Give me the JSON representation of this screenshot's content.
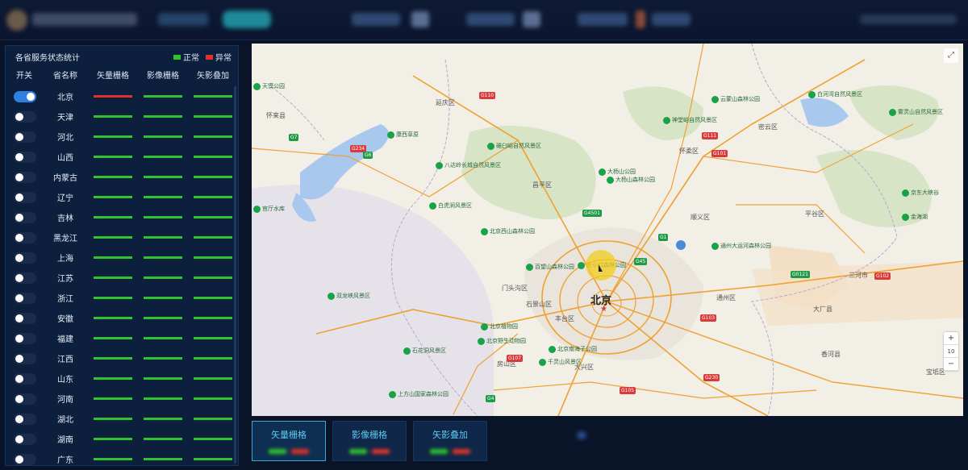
{
  "panel": {
    "title": "各省服务状态统计",
    "legend": [
      {
        "label": "正常",
        "color": "#2fc32f"
      },
      {
        "label": "异常",
        "color": "#e0322a"
      }
    ],
    "columns": [
      "开关",
      "省名称",
      "矢量栅格",
      "影像栅格",
      "矢影叠加"
    ],
    "rows": [
      {
        "name": "北京",
        "on": true,
        "status": [
          "abnormal",
          "normal",
          "normal"
        ]
      },
      {
        "name": "天津",
        "on": false,
        "status": [
          "normal",
          "normal",
          "normal"
        ]
      },
      {
        "name": "河北",
        "on": false,
        "status": [
          "normal",
          "normal",
          "normal"
        ]
      },
      {
        "name": "山西",
        "on": false,
        "status": [
          "normal",
          "normal",
          "normal"
        ]
      },
      {
        "name": "内蒙古",
        "on": false,
        "status": [
          "normal",
          "normal",
          "normal"
        ]
      },
      {
        "name": "辽宁",
        "on": false,
        "status": [
          "normal",
          "normal",
          "normal"
        ]
      },
      {
        "name": "吉林",
        "on": false,
        "status": [
          "normal",
          "normal",
          "normal"
        ]
      },
      {
        "name": "黑龙江",
        "on": false,
        "status": [
          "normal",
          "normal",
          "normal"
        ]
      },
      {
        "name": "上海",
        "on": false,
        "status": [
          "normal",
          "normal",
          "normal"
        ]
      },
      {
        "name": "江苏",
        "on": false,
        "status": [
          "normal",
          "normal",
          "normal"
        ]
      },
      {
        "name": "浙江",
        "on": false,
        "status": [
          "normal",
          "normal",
          "normal"
        ]
      },
      {
        "name": "安徽",
        "on": false,
        "status": [
          "normal",
          "normal",
          "normal"
        ]
      },
      {
        "name": "福建",
        "on": false,
        "status": [
          "normal",
          "normal",
          "normal"
        ]
      },
      {
        "name": "江西",
        "on": false,
        "status": [
          "normal",
          "normal",
          "normal"
        ]
      },
      {
        "name": "山东",
        "on": false,
        "status": [
          "normal",
          "normal",
          "normal"
        ]
      },
      {
        "name": "河南",
        "on": false,
        "status": [
          "normal",
          "normal",
          "normal"
        ]
      },
      {
        "name": "湖北",
        "on": false,
        "status": [
          "normal",
          "normal",
          "normal"
        ]
      },
      {
        "name": "湖南",
        "on": false,
        "status": [
          "normal",
          "normal",
          "normal"
        ]
      },
      {
        "name": "广东",
        "on": false,
        "status": [
          "normal",
          "normal",
          "normal"
        ]
      }
    ],
    "colors": {
      "normal": "#2fc32f",
      "abnormal": "#e0322a"
    }
  },
  "map": {
    "capital": "北京",
    "zoom_level": "10",
    "zoom_in": "+",
    "zoom_out": "−",
    "fullscreen": "⤢",
    "places": [
      {
        "t": "怀来县"
      },
      {
        "t": "延庆区"
      },
      {
        "t": "密云区"
      },
      {
        "t": "怀柔区"
      },
      {
        "t": "昌平区"
      },
      {
        "t": "顺义区"
      },
      {
        "t": "平谷区"
      },
      {
        "t": "门头沟区"
      },
      {
        "t": "石景山区"
      },
      {
        "t": "丰台区"
      },
      {
        "t": "通州区"
      },
      {
        "t": "三河市"
      },
      {
        "t": "大厂县"
      },
      {
        "t": "香河县"
      },
      {
        "t": "房山区"
      },
      {
        "t": "大兴区"
      },
      {
        "t": "宝坻区"
      }
    ],
    "pois": [
      {
        "t": "天漠公园"
      },
      {
        "t": "官厅水库"
      },
      {
        "t": "康西草原"
      },
      {
        "t": "八达岭长城自然风景区"
      },
      {
        "t": "碓臼峪自然风景区"
      },
      {
        "t": "大杨山森林公园"
      },
      {
        "t": "神堂峪自然风景区"
      },
      {
        "t": "云蒙山森林公园"
      },
      {
        "t": "白河湾自然风景区"
      },
      {
        "t": "雾灵山自然风景区"
      },
      {
        "t": "白虎涧风景区"
      },
      {
        "t": "北京西山森林公园"
      },
      {
        "t": "百望山森林公园"
      },
      {
        "t": "东小口森林公园"
      },
      {
        "t": "北京植物园"
      },
      {
        "t": "京东大峡谷"
      },
      {
        "t": "双龙峡风景区"
      },
      {
        "t": "北京野生动物园"
      },
      {
        "t": "上方山国家森林公园"
      },
      {
        "t": "千灵山风景区"
      },
      {
        "t": "北京南海子公园"
      },
      {
        "t": "石花洞风景区"
      },
      {
        "t": "通州大运河森林公园"
      },
      {
        "t": "大杨山公园"
      },
      {
        "t": "金海湖"
      }
    ],
    "shields": [
      {
        "t": "G234",
        "c": "r"
      },
      {
        "t": "G7",
        "c": "g"
      },
      {
        "t": "G6",
        "c": "g"
      },
      {
        "t": "G110",
        "c": "r"
      },
      {
        "t": "G45",
        "c": "g"
      },
      {
        "t": "G111",
        "c": "r"
      },
      {
        "t": "G101",
        "c": "r"
      },
      {
        "t": "G4501",
        "c": "g"
      },
      {
        "t": "G1",
        "c": "g"
      },
      {
        "t": "G102",
        "c": "r"
      },
      {
        "t": "G103",
        "c": "r"
      },
      {
        "t": "G107",
        "c": "r"
      },
      {
        "t": "G4",
        "c": "g"
      },
      {
        "t": "G230",
        "c": "r"
      },
      {
        "t": "G105",
        "c": "r"
      },
      {
        "t": "G0121",
        "c": "g"
      }
    ]
  },
  "tabs": [
    {
      "label": "矢量栅格",
      "active": true
    },
    {
      "label": "影像栅格",
      "active": false
    },
    {
      "label": "矢影叠加",
      "active": false
    }
  ]
}
